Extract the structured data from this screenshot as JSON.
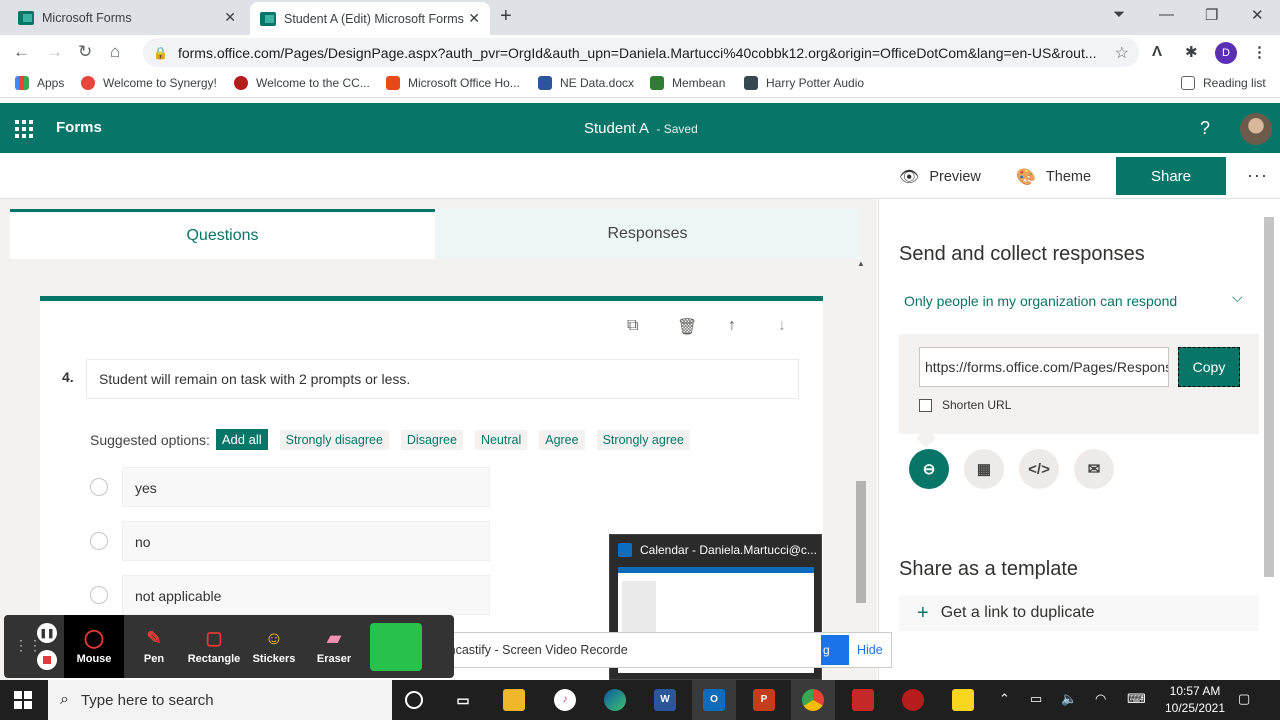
{
  "browser": {
    "tabs": [
      {
        "label": "Microsoft Forms",
        "close": "✕"
      },
      {
        "label": "Student A (Edit) Microsoft Forms",
        "close": "✕"
      }
    ],
    "new_tab": "+",
    "url": "forms.office.com/Pages/DesignPage.aspx?auth_pvr=OrgId&auth_upn=Daniela.Martucci%40cobbk12.org&origin=OfficeDotCom&lang=en-US&rout...",
    "profile_initial": "D",
    "bookmarks": [
      {
        "label": "Apps",
        "color": "#4285f4"
      },
      {
        "label": "Welcome to Synergy!",
        "color": "#e8453c"
      },
      {
        "label": "Welcome to the CC...",
        "color": "#b71c1c"
      },
      {
        "label": "Microsoft Office Ho...",
        "color": "#e64a19"
      },
      {
        "label": "NE Data.docx",
        "color": "#2b579a"
      },
      {
        "label": "Membean",
        "color": "#2e7d32"
      },
      {
        "label": "Harry Potter Audio",
        "color": "#37474f"
      }
    ],
    "reading_list": "Reading list"
  },
  "forms": {
    "app_name": "Forms",
    "doc_title": "Student A",
    "doc_status": "- Saved",
    "help": "?",
    "toolbar": {
      "preview": "Preview",
      "theme": "Theme",
      "share": "Share",
      "more": "···"
    },
    "tabs": {
      "questions": "Questions",
      "responses": "Responses"
    },
    "question": {
      "number": "4.",
      "text": "Student will remain on task with 2 prompts or less.",
      "suggested_label": "Suggested options:",
      "add_all": "Add all",
      "suggestions": [
        "Strongly disagree",
        "Disagree",
        "Neutral",
        "Agree",
        "Strongly agree"
      ],
      "options": [
        "yes",
        "no",
        "not applicable"
      ]
    }
  },
  "share_panel": {
    "title": "Send and collect responses",
    "audience": "Only people in my organization can respond",
    "link": "https://forms.office.com/Pages/ResponsePage.aspx",
    "copy": "Copy",
    "shorten": "Shorten URL",
    "template_title": "Share as a template",
    "duplicate_link": "Get a link to duplicate"
  },
  "outlook_thumb": {
    "title": "Calendar - Daniela.Martucci@c..."
  },
  "screencastify": {
    "tools": [
      "Mouse",
      "Pen",
      "Rectangle",
      "Stickers",
      "Eraser"
    ],
    "notice": "Screencastify - Screen Video Recorde",
    "notice_btn": "g",
    "hide": "Hide"
  },
  "taskbar": {
    "search_placeholder": "Type here to search",
    "time": "10:57 AM",
    "date": "10/25/2021"
  }
}
